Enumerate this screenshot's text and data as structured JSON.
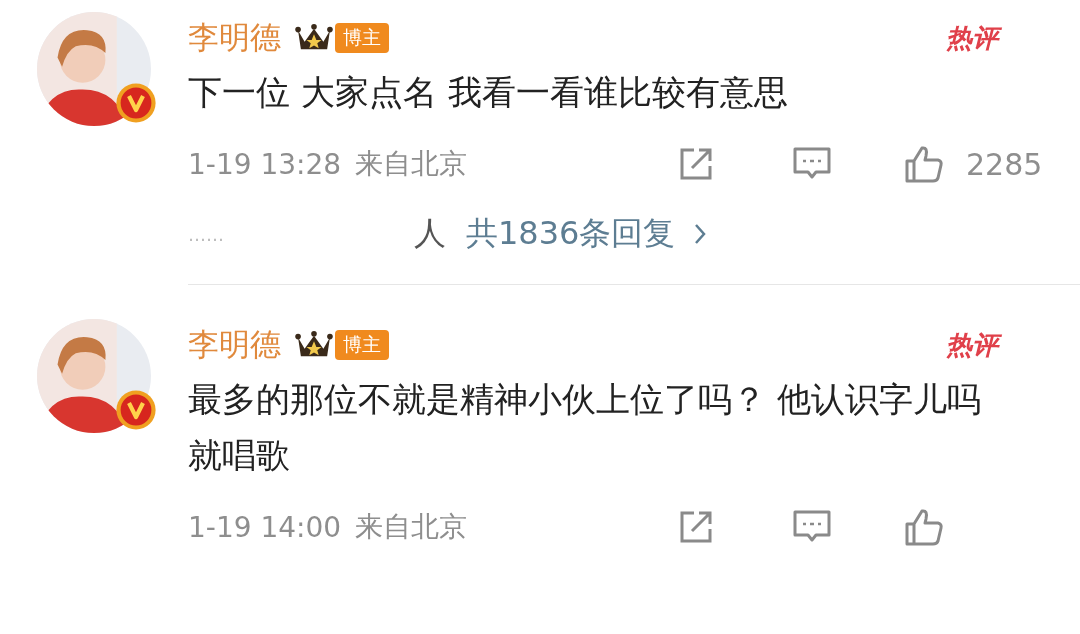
{
  "comments": [
    {
      "author": "李明德",
      "badge": "博主",
      "hot_label": "热评",
      "verified": true,
      "text": "下一位 大家点名 我看一看谁比较有意思",
      "time": "1-19 13:28",
      "location": "来自北京",
      "likes": "2285",
      "replies": {
        "ellipsis": "……",
        "fragment": "人",
        "link": "共1836条回复"
      }
    },
    {
      "author": "李明德",
      "badge": "博主",
      "hot_label": "热评",
      "verified": true,
      "text": "最多的那位不就是精神小伙上位了吗？ 他认识字儿吗就唱歌",
      "time": "1-19 14:00",
      "location": "来自北京"
    }
  ]
}
